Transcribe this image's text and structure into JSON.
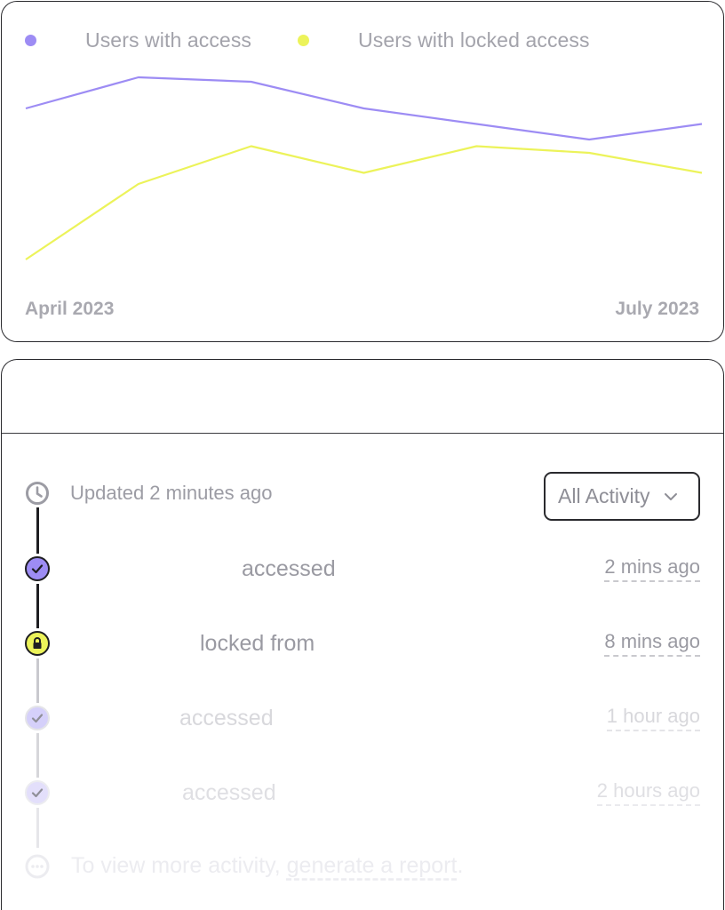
{
  "chart_data": {
    "type": "line",
    "x_start_label": "April 2023",
    "x_end_label": "July 2023",
    "x": [
      0,
      1,
      2,
      3,
      4,
      5,
      6
    ],
    "ylim": [
      0,
      100
    ],
    "series": [
      {
        "name": "Users with access",
        "color": "#9d8cf4",
        "values": [
          76,
          90,
          88,
          76,
          69,
          62,
          69
        ]
      },
      {
        "name": "Users with locked access",
        "color": "#ecf35a",
        "values": [
          8,
          42,
          59,
          47,
          59,
          56,
          47
        ]
      }
    ]
  },
  "activity": {
    "header_title": "",
    "updated_text": "Updated 2 minutes ago",
    "filter_label": "All Activity",
    "events": [
      {
        "action": "accessed",
        "time": "2 mins ago",
        "icon": "check-icon",
        "node_color": "#9d8cf4"
      },
      {
        "action": "locked from",
        "time": "8 mins ago",
        "icon": "lock-icon",
        "node_color": "#ecf35a"
      },
      {
        "action": "accessed",
        "time": "1 hour ago",
        "icon": "check-icon",
        "node_color": "#d5d0fa"
      },
      {
        "action": "accessed",
        "time": "2 hours ago",
        "icon": "check-icon",
        "node_color": "#e3dffb"
      }
    ],
    "footer_text": "To view more activity, ",
    "footer_link": "generate a report",
    "footer_end": "."
  }
}
